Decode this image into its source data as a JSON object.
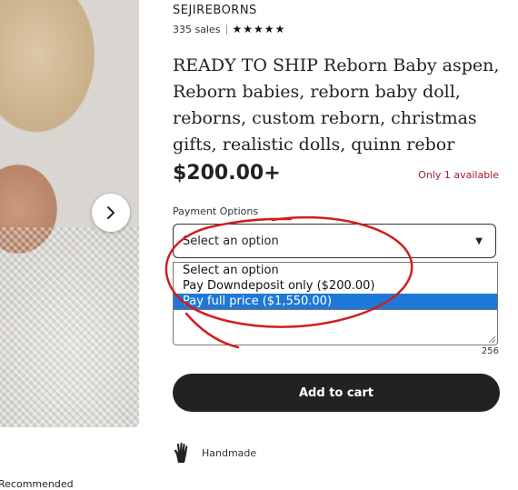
{
  "shop": {
    "name": "SEJIREBORNS",
    "sales": "335 sales",
    "rating_stars": 5
  },
  "listing": {
    "title": "READY TO SHIP Reborn Baby aspen, Reborn babies, reborn baby doll, reborns, custom reborn, christmas gifts, realistic dolls, quinn rebor",
    "price": "$200.00+",
    "availability": "Only 1 available",
    "availability_color": "#a61a2e"
  },
  "payment": {
    "label": "Payment Options",
    "select_value": "Select an option",
    "options": [
      {
        "label": "Select an option",
        "selected": false
      },
      {
        "label": "Pay Downdeposit only ($200.00)",
        "selected": false
      },
      {
        "label": "Pay full price ($1,550.00)",
        "selected": true
      }
    ],
    "highlight_color": "#1e78d7"
  },
  "personalization": {
    "char_count": "256"
  },
  "cart": {
    "button_label": "Add to cart",
    "button_color": "#222222"
  },
  "features": {
    "handmade_label": "Handmade"
  },
  "footer": {
    "recommended_label": "Recommended"
  },
  "annotation": {
    "stroke_color": "#d01f1f"
  }
}
